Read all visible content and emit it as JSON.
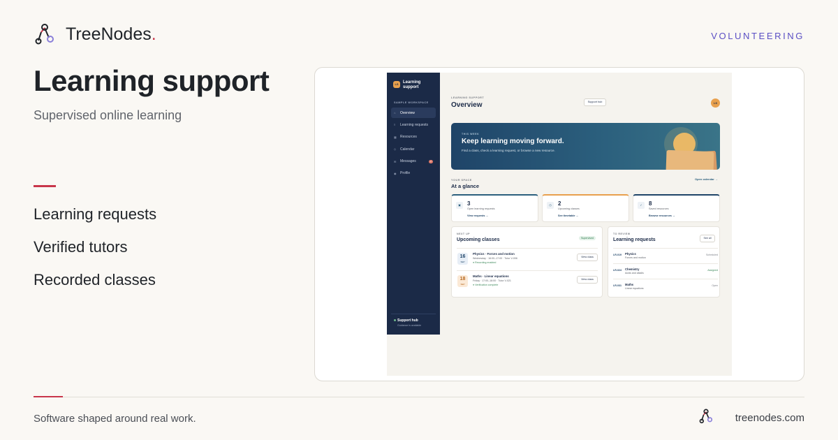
{
  "brand": {
    "name": "TreeNodes",
    "dot": "."
  },
  "category": "VOLUNTEERING",
  "headline": "Learning support",
  "subline": "Supervised online learning",
  "features": [
    "Learning requests",
    "Verified tutors",
    "Recorded classes"
  ],
  "footer": {
    "tagline": "Software shaped around real work.",
    "domain": "treenodes.com"
  },
  "colors": {
    "accent_red": "#c8364a",
    "accent_purple": "#5b4fc4",
    "navy": "#1b2a47",
    "amber": "#e8a04d",
    "teal": "#2b5f7d"
  },
  "app": {
    "sidebar": {
      "logo_initials": "LS",
      "title": "Learning support",
      "section": "SAMPLE WORKSPACE",
      "nav": [
        {
          "label": "Overview",
          "icon": "home-icon",
          "glyph": "⌂",
          "active": true
        },
        {
          "label": "Learning requests",
          "icon": "request-icon",
          "glyph": "≡",
          "active": false
        },
        {
          "label": "Resources",
          "icon": "grid-icon",
          "glyph": "▦",
          "active": false
        },
        {
          "label": "Calendar",
          "icon": "calendar-icon",
          "glyph": "◇",
          "active": false
        },
        {
          "label": "Messages",
          "icon": "message-icon",
          "glyph": "✉",
          "active": false,
          "badge": "2"
        },
        {
          "label": "Profile",
          "icon": "profile-icon",
          "glyph": "◉",
          "active": false
        }
      ],
      "footer_title": "Support hub",
      "footer_sub": "Guidance is available"
    },
    "header": {
      "label": "LEARNING SUPPORT",
      "title": "Overview",
      "button": "Support hub",
      "avatar": "LS"
    },
    "hero": {
      "kicker": "THIS WEEK",
      "title": "Keep learning moving forward.",
      "subtitle": "Find a class, check a learning request, or browse a new resource."
    },
    "space": {
      "label": "YOUR SPACE",
      "title": "At a glance",
      "link": "Open calendar →"
    },
    "stats": [
      {
        "number": "3",
        "label": "Open learning requests",
        "action": "View requests →",
        "icon": "request-icon",
        "glyph": "▣",
        "accent": "#2b5f7d"
      },
      {
        "number": "2",
        "label": "Upcoming classes",
        "action": "See timetable →",
        "icon": "class-icon",
        "glyph": "◷",
        "accent": "#e8a04d"
      },
      {
        "number": "8",
        "label": "Saved resources",
        "action": "Browse resources →",
        "icon": "check-icon",
        "glyph": "✓",
        "accent": "#1f4468"
      }
    ],
    "classes": {
      "kicker": "NEXT UP",
      "title": "Upcoming classes",
      "badge": "Supervised",
      "rows": [
        {
          "day": "16",
          "month": "SEP",
          "title": "Physics · Forces and motion",
          "sub": "Wednesday · 16:00–17:00 · Tutor V-006",
          "note": "● Recording enabled",
          "button": "View class"
        },
        {
          "day": "18",
          "month": "SEP",
          "title": "Maths · Linear equations",
          "sub": "Friday · 17:00–18:00 · Tutor V-021",
          "note": "● Verification complete",
          "button": "View class"
        }
      ]
    },
    "requests": {
      "kicker": "TO REVIEW",
      "title": "Learning requests",
      "button": "See all",
      "rows": [
        {
          "id": "LR-019",
          "title": "Physics",
          "sub": "Forces and motion",
          "status": "Scheduled",
          "status_color": "#7b7f86"
        },
        {
          "id": "LR-024",
          "title": "Chemistry",
          "sub": "Acids and alkalis",
          "status": "Assigned",
          "status_color": "#3f8a5c"
        },
        {
          "id": "LR-031",
          "title": "Maths",
          "sub": "Linear equations",
          "status": "Open",
          "status_color": "#7b7f86"
        }
      ]
    }
  }
}
